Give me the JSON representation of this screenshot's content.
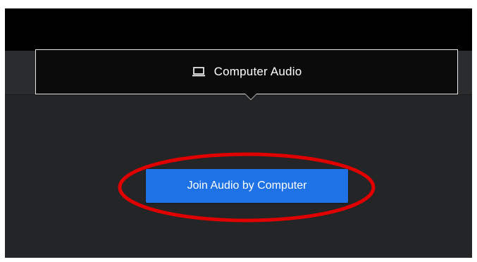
{
  "audio_tab": {
    "label": "Computer Audio",
    "icon": "laptop-icon"
  },
  "join_button": {
    "label": "Join Audio by Computer"
  },
  "colors": {
    "top_bar": "#000000",
    "panel_background": "#242526",
    "tab_background": "#0b0b0b",
    "tab_border": "#e6e6e6",
    "button_blue": "#1e72e6",
    "annotation_red": "#e00000"
  }
}
